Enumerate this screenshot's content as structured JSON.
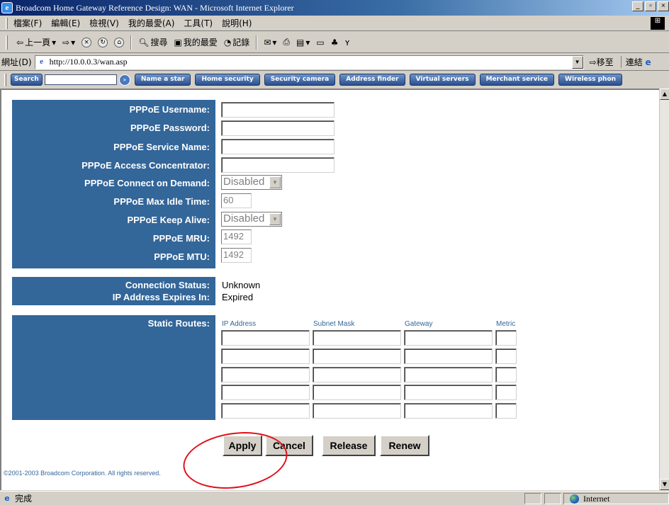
{
  "window": {
    "title": "Broadcom Home Gateway Reference Design: WAN - Microsoft Internet Explorer",
    "buttons": [
      "_",
      "б",
      "×"
    ]
  },
  "menu": [
    "檔案(F)",
    "編輯(E)",
    "檢視(V)",
    "我的最愛(A)",
    "工具(T)",
    "說明(H)"
  ],
  "toolbar": {
    "back": "上一頁",
    "search": "搜尋",
    "favorites": "我的最愛",
    "history": "記錄"
  },
  "address": {
    "label": "網址(D)",
    "url": "http://10.0.0.3/wan.asp",
    "go": "移至",
    "links": "連結"
  },
  "linksbar": {
    "search": "Search",
    "items": [
      "Name a star",
      "Home security",
      "Security camera",
      "Address finder",
      "Virtual servers",
      "Merchant service",
      "Wireless phon"
    ]
  },
  "pppoe": {
    "username_label": "PPPoE Username:",
    "password_label": "PPPoE Password:",
    "service_label": "PPPoE Service Name:",
    "ac_label": "PPPoE Access Concentrator:",
    "demand_label": "PPPoE Connect on Demand:",
    "demand_value": "Disabled",
    "idle_label": "PPPoE Max Idle Time:",
    "idle_value": "60",
    "keepalive_label": "PPPoE Keep Alive:",
    "keepalive_value": "Disabled",
    "mru_label": "PPPoE MRU:",
    "mru_value": "1492",
    "mtu_label": "PPPoE MTU:",
    "mtu_value": "1492"
  },
  "connection": {
    "status_label": "Connection Status:",
    "status_value": "Unknown",
    "expires_label": "IP Address Expires In:",
    "expires_value": "Expired"
  },
  "routes": {
    "label": "Static Routes:",
    "columns": [
      "IP Address",
      "Subnet Mask",
      "Gateway",
      "Metric"
    ]
  },
  "buttons": {
    "apply": "Apply",
    "cancel": "Cancel",
    "release": "Release",
    "renew": "Renew"
  },
  "copyright": "©2001-2003 Broadcom Corporation. All rights reserved.",
  "status": {
    "text": "完成",
    "zone": "Internet"
  },
  "colors": {
    "panel": "#336699",
    "annotation": "#e0101a"
  }
}
